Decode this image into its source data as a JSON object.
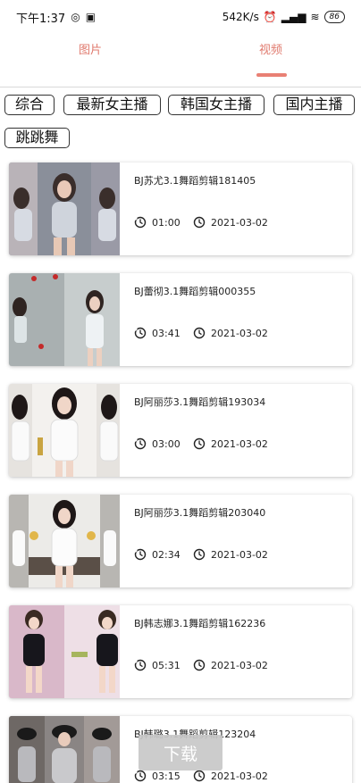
{
  "status_bar": {
    "time": "下午1:37",
    "speed": "542K/s",
    "battery": "86"
  },
  "tabs": [
    {
      "label": "图片",
      "active": false
    },
    {
      "label": "视频",
      "active": true
    }
  ],
  "accent_color": "#e98074",
  "filters": [
    "综合",
    "最新女主播",
    "韩国女主播",
    "国内主播",
    "跳跳舞"
  ],
  "videos": [
    {
      "title": "BJ苏尤3.1舞蹈剪辑181405",
      "duration": "01:00",
      "date": "2021-03-02"
    },
    {
      "title": "BJ蕾彻3.1舞蹈剪辑000355",
      "duration": "03:41",
      "date": "2021-03-02"
    },
    {
      "title": "BJ阿丽莎3.1舞蹈剪辑193034",
      "duration": "03:00",
      "date": "2021-03-02"
    },
    {
      "title": "BJ阿丽莎3.1舞蹈剪辑203040",
      "duration": "02:34",
      "date": "2021-03-02"
    },
    {
      "title": "BJ韩志娜3.1舞蹈剪辑162236",
      "duration": "05:31",
      "date": "2021-03-02"
    },
    {
      "title": "BJ韩璐3.1舞蹈剪辑123204",
      "duration": "03:15",
      "date": "2021-03-02"
    }
  ],
  "download_label": "下载"
}
